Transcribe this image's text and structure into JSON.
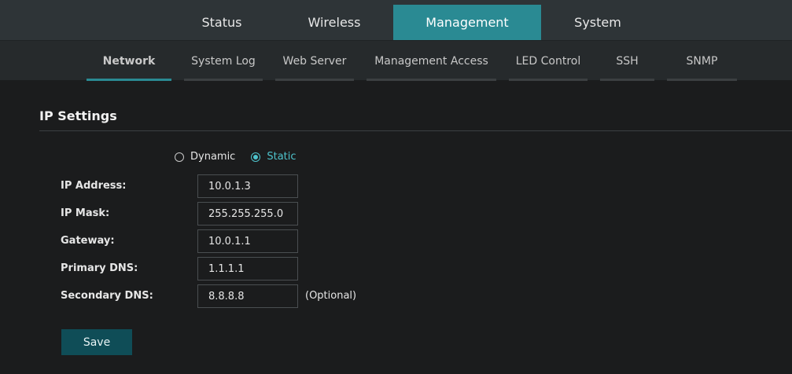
{
  "top_nav": {
    "tabs": [
      {
        "label": "Status"
      },
      {
        "label": "Wireless"
      },
      {
        "label": "Management"
      },
      {
        "label": "System"
      }
    ],
    "active": "Management"
  },
  "sub_nav": {
    "tabs": [
      {
        "label": "Network"
      },
      {
        "label": "System Log"
      },
      {
        "label": "Web Server"
      },
      {
        "label": "Management Access"
      },
      {
        "label": "LED Control"
      },
      {
        "label": "SSH"
      },
      {
        "label": "SNMP"
      }
    ],
    "active": "Network"
  },
  "ip_settings": {
    "title": "IP Settings",
    "mode_options": [
      {
        "label": "Dynamic",
        "checked": false
      },
      {
        "label": "Static",
        "checked": true
      }
    ],
    "fields": {
      "ip_address": {
        "label": "IP Address:",
        "value": "10.0.1.3"
      },
      "ip_mask": {
        "label": "IP Mask:",
        "value": "255.255.255.0"
      },
      "gateway": {
        "label": "Gateway:",
        "value": "10.0.1.1"
      },
      "primary_dns": {
        "label": "Primary DNS:",
        "value": "1.1.1.1"
      },
      "secondary_dns": {
        "label": "Secondary DNS:",
        "value": "8.8.8.8",
        "hint": "(Optional)"
      }
    },
    "save_label": "Save"
  },
  "colors": {
    "accent": "#2a8a93",
    "radio_accent": "#4ec3cc",
    "save_button": "#0f4d57",
    "background": "#1b1c1d"
  }
}
